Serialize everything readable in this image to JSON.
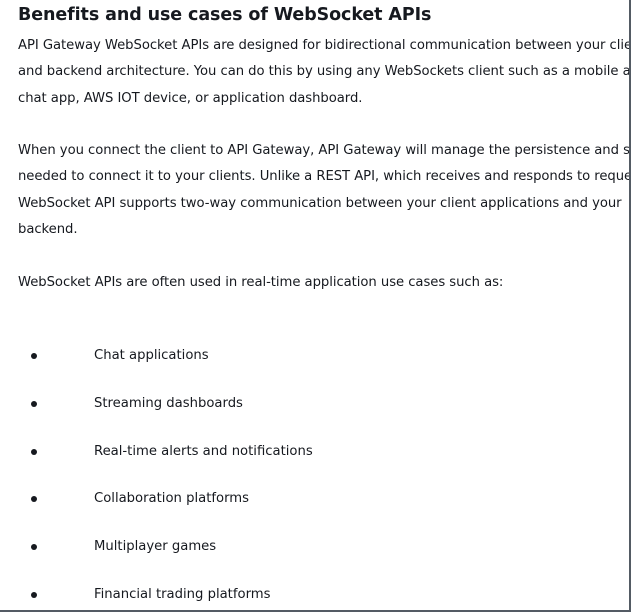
{
  "section": {
    "title": "Benefits and use cases of WebSocket APIs",
    "paragraph1": [
      "API Gateway WebSocket APIs are designed for bidirectional communication between your client",
      "and backend architecture. You can do this by using any WebSockets client such as a mobile app,",
      "chat app, AWS IOT device, or application dashboard."
    ],
    "paragraph2": [
      "When you connect the client to API Gateway, API Gateway will manage the persistence and state",
      "needed to connect it to your clients. Unlike a REST API, which receives and responds to requests, a",
      "WebSocket API supports two-way communication between your client applications and your",
      "backend."
    ],
    "paragraph3": [
      "WebSocket APIs are often used in real-time application use cases such as:"
    ],
    "use_cases": [
      "Chat applications",
      "Streaming dashboards",
      "Real-time alerts and notifications",
      "Collaboration platforms",
      "Multiplayer games",
      "Financial trading platforms"
    ]
  }
}
